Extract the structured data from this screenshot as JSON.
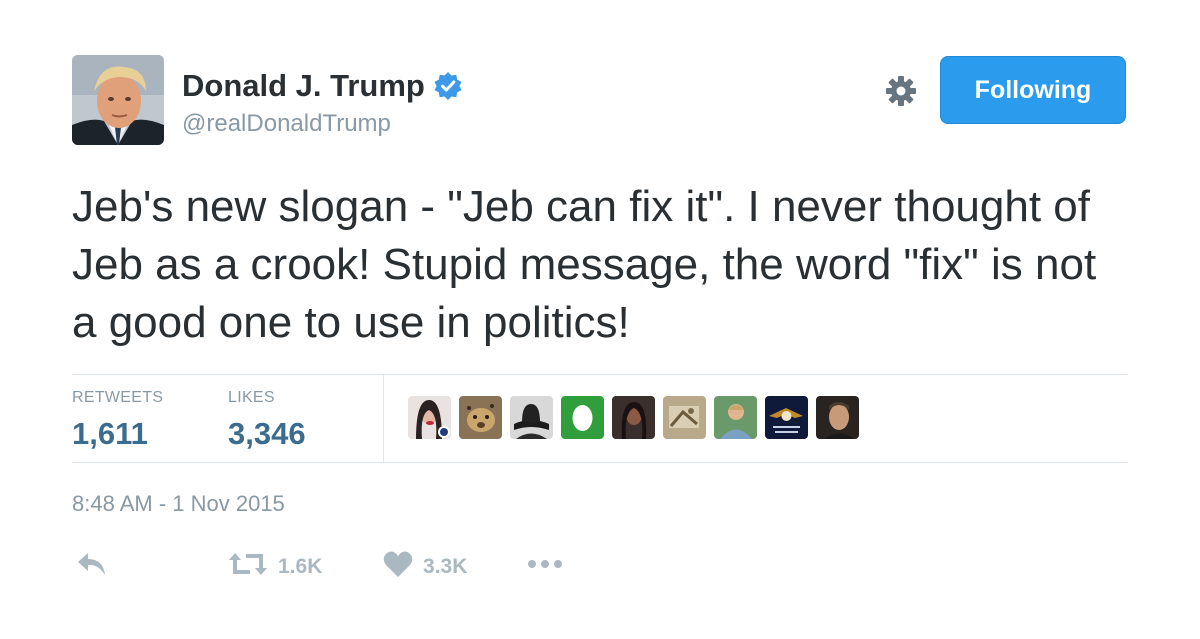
{
  "author": {
    "name": "Donald J. Trump",
    "handle": "@realDonaldTrump",
    "verified_icon": "verified-badge-icon"
  },
  "header": {
    "follow_label": "Following",
    "settings_icon": "gear-icon"
  },
  "tweet": {
    "text": "Jeb's new slogan - \"Jeb can fix it\". I never thought of Jeb as a crook! Stupid message, the word \"fix\" is not a good one to use in politics!"
  },
  "stats": {
    "retweets_label": "RETWEETS",
    "retweets_value": "1,611",
    "likes_label": "LIKES",
    "likes_value": "3,346",
    "liker_avatars_count": 9
  },
  "timestamp": "8:48 AM - 1 Nov 2015",
  "actions": {
    "reply_icon": "reply-icon",
    "retweet_icon": "retweet-icon",
    "retweet_count": "1.6K",
    "like_icon": "heart-icon",
    "like_count": "3.3K",
    "more_icon": "more-icon"
  },
  "colors": {
    "accent": "#2b9bed",
    "stat_value": "#3b6c8e",
    "muted": "#8899a6",
    "action_gray": "#aab8c2",
    "divider": "#e1e8ed"
  }
}
